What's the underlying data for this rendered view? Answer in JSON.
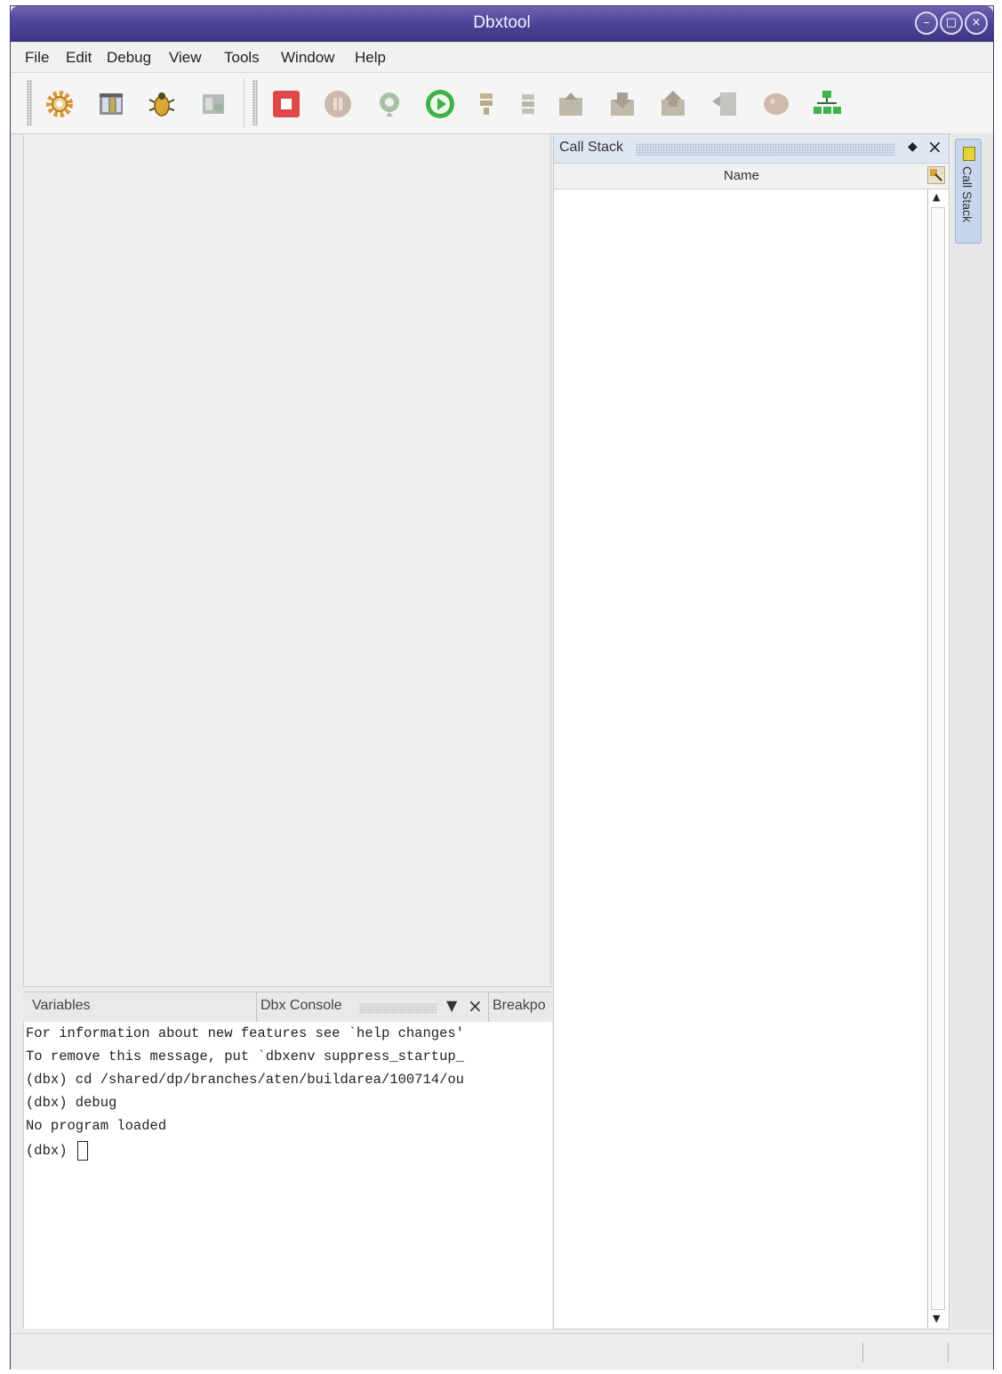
{
  "window": {
    "title": "Dbxtool",
    "controls": [
      "minimize",
      "maximize",
      "close"
    ]
  },
  "menu": [
    "File",
    "Edit",
    "Debug",
    "View",
    "Tools",
    "Window",
    "Help"
  ],
  "toolbar": {
    "icons": [
      "options-gear-icon",
      "executable-icon",
      "debug-bug-icon",
      "attach-process-icon",
      "stop-icon",
      "pause-icon",
      "restart-icon",
      "continue-icon",
      "step-over-icon",
      "step-into-icon",
      "step-out-icon",
      "up-stack-icon",
      "down-stack-icon",
      "run-to-cursor-icon",
      "fix-icon",
      "network-icon"
    ]
  },
  "bottom_tabs": {
    "variables": "Variables",
    "console": "Dbx Console",
    "breakpoints": "Breakpo"
  },
  "console": {
    "lines": [
      "For information about new features see `help changes'",
      "To remove this message, put `dbxenv suppress_startup_",
      "(dbx) cd /shared/dp/branches/aten/buildarea/100714/ou",
      "(dbx) debug",
      "No program loaded",
      "(dbx) "
    ]
  },
  "call_stack": {
    "title": "Call Stack",
    "column": "Name",
    "side_tab": "Call Stack"
  },
  "colors": {
    "titlebar": "#4e479a",
    "panel_header": "#dfe7f3",
    "accent_green": "#3db34a",
    "stop_red": "#e04848"
  }
}
